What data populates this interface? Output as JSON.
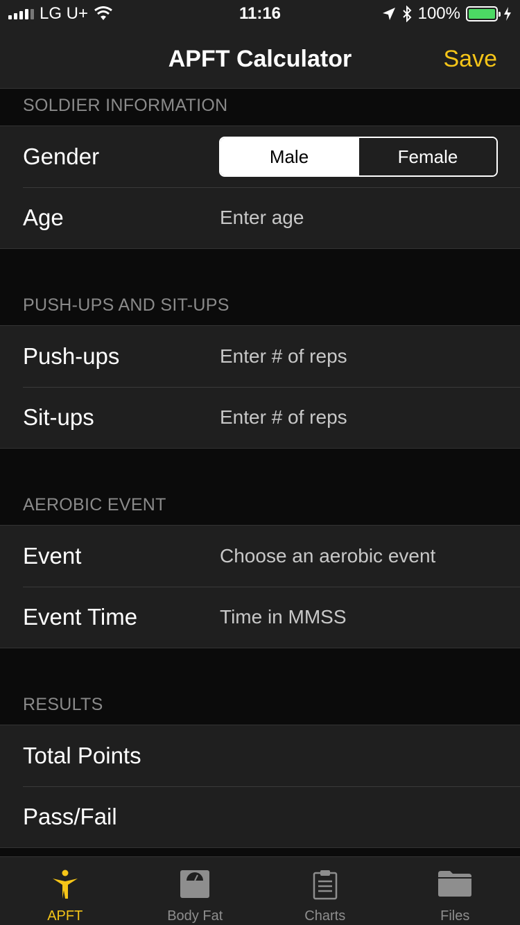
{
  "status_bar": {
    "carrier": "LG U+",
    "time": "11:16",
    "battery": "100%",
    "battery_level": 1.0
  },
  "nav": {
    "title": "APFT Calculator",
    "save_label": "Save"
  },
  "sections": {
    "soldier": {
      "header": "SOLDIER INFORMATION",
      "gender_label": "Gender",
      "gender_options": [
        "Male",
        "Female"
      ],
      "gender_selected": "Male",
      "age_label": "Age",
      "age_placeholder": "Enter age"
    },
    "pushups_situps": {
      "header": "PUSH-UPS AND SIT-UPS",
      "pushups_label": "Push-ups",
      "pushups_placeholder": "Enter # of reps",
      "situps_label": "Sit-ups",
      "situps_placeholder": "Enter # of reps"
    },
    "aerobic": {
      "header": "AEROBIC EVENT",
      "event_label": "Event",
      "event_placeholder": "Choose an aerobic event",
      "time_label": "Event Time",
      "time_placeholder": "Time in MMSS"
    },
    "results": {
      "header": "RESULTS",
      "total_label": "Total Points",
      "passfail_label": "Pass/Fail"
    }
  },
  "tabs": [
    {
      "label": "APFT",
      "icon": "apft-figure-icon",
      "active": true
    },
    {
      "label": "Body Fat",
      "icon": "scale-icon",
      "active": false
    },
    {
      "label": "Charts",
      "icon": "clipboard-icon",
      "active": false
    },
    {
      "label": "Files",
      "icon": "folder-icon",
      "active": false
    }
  ],
  "colors": {
    "accent": "#f5c518",
    "battery": "#4cd964",
    "background": "#0b0b0b",
    "cell": "#1f1f1f"
  }
}
